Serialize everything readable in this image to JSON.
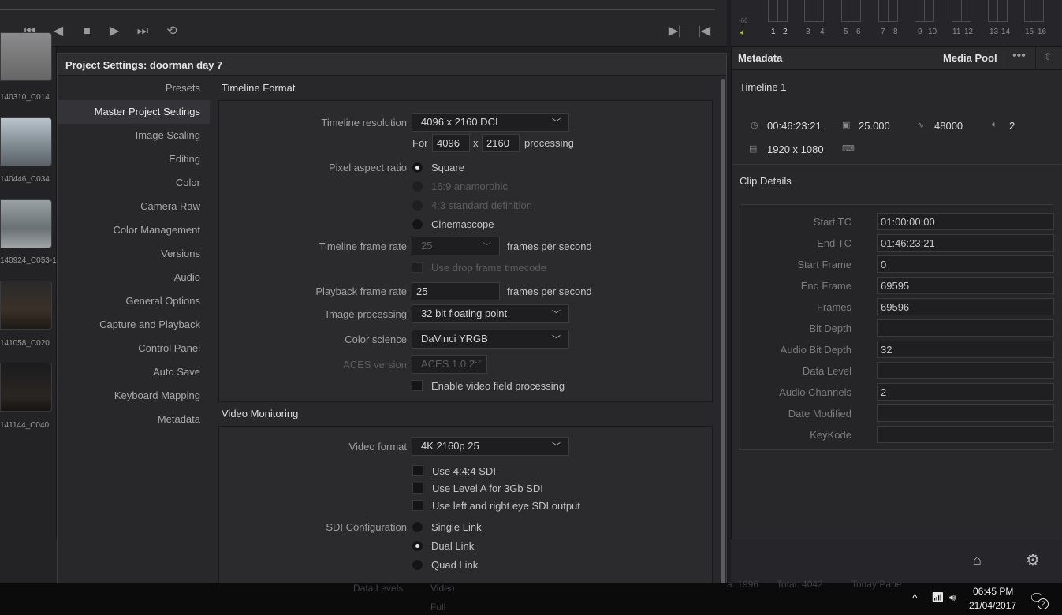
{
  "meters": {
    "labels": [
      "1",
      "2",
      "3",
      "4",
      "5",
      "6",
      "7",
      "8",
      "9",
      "10",
      "11",
      "12",
      "13",
      "14",
      "15",
      "16"
    ],
    "db_label": "-60"
  },
  "clips": [
    "140310_C014",
    "140446_C034",
    "140924_C053-1",
    "141058_C020",
    "141144_C040"
  ],
  "dialog": {
    "title": "Project Settings:  doorman day 7",
    "nav": [
      "Presets",
      "Master Project Settings",
      "Image Scaling",
      "Editing",
      "Color",
      "Camera Raw",
      "Color Management",
      "Versions",
      "Audio",
      "General Options",
      "Capture and Playback",
      "Control Panel",
      "Auto Save",
      "Keyboard Mapping",
      "Metadata"
    ],
    "nav_selected": "Master Project Settings",
    "timeline_format": {
      "title": "Timeline Format",
      "timeline_resolution_label": "Timeline resolution",
      "timeline_resolution": "4096 x 2160 DCI",
      "for_label": "For",
      "width": "4096",
      "x_label": "x",
      "height": "2160",
      "processing_label": "processing",
      "pixel_aspect_label": "Pixel aspect ratio",
      "pixel_options": [
        "Square",
        "16:9 anamorphic",
        "4:3 standard definition",
        "Cinemascope"
      ],
      "frame_rate_label": "Timeline frame rate",
      "frame_rate": "25",
      "fps_label": "frames per second",
      "drop_frame_label": "Use drop frame timecode",
      "playback_label": "Playback frame rate",
      "playback_rate": "25",
      "playback_fps_label": "frames per second",
      "image_processing_label": "Image processing",
      "image_processing": "32 bit floating point",
      "color_science_label": "Color science",
      "color_science": "DaVinci YRGB",
      "aces_label": "ACES version",
      "aces_version": "ACES 1.0.2",
      "field_processing_label": "Enable video field processing"
    },
    "video_monitoring": {
      "title": "Video Monitoring",
      "video_format_label": "Video format",
      "video_format": "4K 2160p 25",
      "checks": [
        "Use 4:4:4 SDI",
        "Use Level A for 3Gb SDI",
        "Use left and right eye SDI output"
      ],
      "sdi_label": "SDI Configuration",
      "sdi_options": [
        "Single Link",
        "Dual Link",
        "Quad Link"
      ],
      "data_levels_label": "Data Levels",
      "data_options": [
        "Video",
        "Full"
      ]
    }
  },
  "metadata": {
    "tab_metadata": "Metadata",
    "tab_media_pool": "Media Pool",
    "timeline_name": "Timeline 1",
    "duration": "00:46:23:21",
    "fps": "25.000",
    "audio_rate": "48000",
    "audio_channels": "2",
    "resolution": "1920 x 1080",
    "clip_details_title": "Clip Details",
    "fields": [
      {
        "label": "Start TC",
        "value": "01:00:00:00"
      },
      {
        "label": "End TC",
        "value": "01:46:23:21"
      },
      {
        "label": "Start Frame",
        "value": "0"
      },
      {
        "label": "End Frame",
        "value": "69595"
      },
      {
        "label": "Frames",
        "value": "69596"
      },
      {
        "label": "Bit Depth",
        "value": ""
      },
      {
        "label": "Audio Bit Depth",
        "value": "32"
      },
      {
        "label": "Data Level",
        "value": ""
      },
      {
        "label": "Audio Channels",
        "value": "2"
      },
      {
        "label": "Date Modified",
        "value": ""
      },
      {
        "label": "KeyKode",
        "value": ""
      }
    ]
  },
  "taskbar": {
    "time": "06:45 PM",
    "date": "21/04/2017",
    "notifications": "2",
    "ghost_left": "a. 1996",
    "ghost_mid": "Total: 4042",
    "ghost_right": "Today Pane"
  }
}
